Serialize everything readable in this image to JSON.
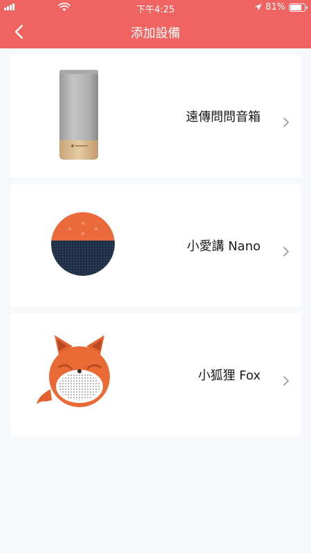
{
  "status_bar": {
    "time": "下午4:25",
    "battery": "81%",
    "battery_level": 0.81
  },
  "header": {
    "title": "添加設備",
    "back_icon": "chevron-left-icon"
  },
  "devices": [
    {
      "label": "遠傳問問音箱",
      "image": "cylinder-speaker-image"
    },
    {
      "label": "小愛講 Nano",
      "image": "round-speaker-image"
    },
    {
      "label": "小狐狸 Fox",
      "image": "fox-speaker-image"
    }
  ],
  "colors": {
    "accent": "#ef6360",
    "background": "#f7f8fa",
    "card": "#ffffff"
  }
}
